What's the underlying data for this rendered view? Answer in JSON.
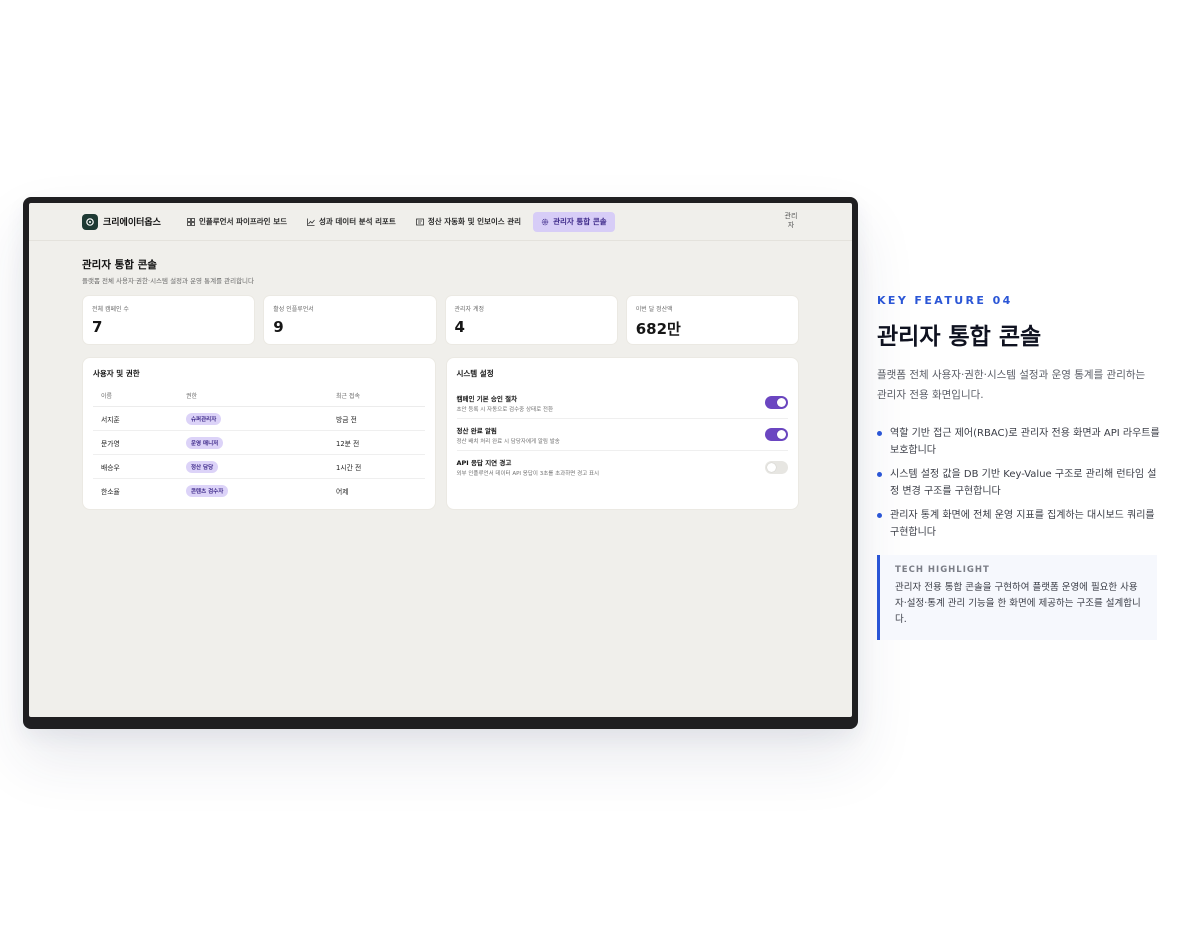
{
  "app": {
    "brand_name": "크리에이터옵스",
    "nav": [
      {
        "label": "인플루언서 파이프라인 보드",
        "icon": "board-icon"
      },
      {
        "label": "성과 데이터 분석 리포트",
        "icon": "chart-icon"
      },
      {
        "label": "정산 자동화 및 인보이스 관리",
        "icon": "invoice-icon"
      },
      {
        "label": "관리자 통합 콘솔",
        "icon": "gear-icon",
        "active": true
      }
    ],
    "avatar_alt": "관리자"
  },
  "page": {
    "title": "관리자 통합 콘솔",
    "subtitle": "플랫폼 전체 사용자·권한·시스템 설정과 운영 통계를 관리합니다"
  },
  "stats": [
    {
      "label": "전체 캠페인 수",
      "value": "7"
    },
    {
      "label": "활성 인플루언서",
      "value": "9"
    },
    {
      "label": "관리자 계정",
      "value": "4"
    },
    {
      "label": "이번 달 정산액",
      "value": "682만"
    }
  ],
  "users_panel": {
    "title": "사용자 및 권한",
    "columns": [
      "이름",
      "권한",
      "최근 접속"
    ],
    "rows": [
      {
        "name": "서지훈",
        "role": "슈퍼관리자",
        "last": "방금 전"
      },
      {
        "name": "문가영",
        "role": "운영 매니저",
        "last": "12분 전"
      },
      {
        "name": "배승우",
        "role": "정산 담당",
        "last": "1시간 전"
      },
      {
        "name": "한소율",
        "role": "콘텐츠 검수자",
        "last": "어제"
      }
    ]
  },
  "settings_panel": {
    "title": "시스템 설정",
    "items": [
      {
        "name": "캠페인 기본 승인 절차",
        "desc": "초안 등록 시 자동으로 검수중 상태로 전환",
        "on": true
      },
      {
        "name": "정산 완료 알림",
        "desc": "정산 배치 처리 완료 시 담당자에게 알림 발송",
        "on": true
      },
      {
        "name": "API 응답 지연 경고",
        "desc": "외부 인플루언서 데이터 API 응답이 3초를 초과하면 경고 표시",
        "on": false
      }
    ]
  },
  "feature": {
    "kicker": "KEY FEATURE 04",
    "title": "관리자 통합 콘솔",
    "description": "플랫폼 전체 사용자·권한·시스템 설정과 운영 통계를 관리하는 관리자 전용 화면입니다.",
    "bullets": [
      "역할 기반 접근 제어(RBAC)로 관리자 전용 화면과 API 라우트를 보호합니다",
      "시스템 설정 값을 DB 기반 Key-Value 구조로 관리해 런타임 설정 변경 구조를 구현합니다",
      "관리자 통계 화면에 전체 운영 지표를 집계하는 대시보드 쿼리를 구현합니다"
    ],
    "highlight_label": "TECH HIGHLIGHT",
    "highlight_text": "관리자 전용 통합 콘솔을 구현하여 플랫폼 운영에 필요한 사용자·설정·통계 관리 기능을 한 화면에 제공하는 구조를 설계합니다."
  },
  "colors": {
    "accent": "#2b56d6",
    "toggle_on": "#6b46c1",
    "nav_active_bg": "#d7cdf7",
    "brand_logo": "#1e3a34"
  }
}
